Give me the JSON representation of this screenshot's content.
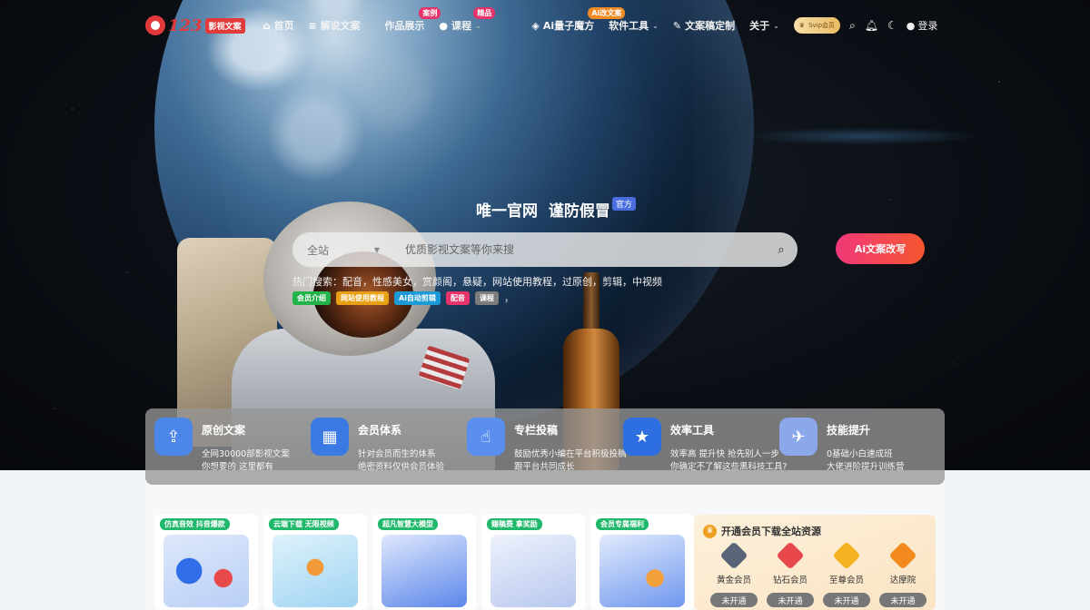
{
  "header": {
    "logo": {
      "number": "123",
      "text": "影视文案"
    },
    "nav": [
      {
        "label": "首页",
        "icon": "home-icon",
        "glyph": "⌂",
        "dropdown": false,
        "tag": ""
      },
      {
        "label": "解说文案",
        "icon": "layers-icon",
        "glyph": "≡",
        "dropdown": true,
        "tag": ""
      },
      {
        "label": "作品展示",
        "icon": "",
        "glyph": "",
        "dropdown": false,
        "tag": "案例"
      },
      {
        "label": "课程",
        "icon": "user-icon",
        "glyph": "●",
        "dropdown": true,
        "tag": "精品"
      },
      {
        "label": "Ai量子魔方",
        "icon": "cube-icon",
        "glyph": "◈",
        "dropdown": false,
        "tag": "Ai改文案"
      },
      {
        "label": "软件工具",
        "icon": "",
        "glyph": "",
        "dropdown": true,
        "tag": ""
      },
      {
        "label": "文案稿定制",
        "icon": "edit-icon",
        "glyph": "✎",
        "dropdown": false,
        "tag": ""
      },
      {
        "label": "关于",
        "icon": "",
        "glyph": "",
        "dropdown": true,
        "tag": ""
      }
    ],
    "svip_label": "Svip会员",
    "login_label": "登录"
  },
  "hero": {
    "slogan": "唯一官网  谨防假冒",
    "badge": "官方",
    "search_scope": "全站",
    "search_placeholder": "优质影视文案等你来搜",
    "ai_button": "Ai文案改写",
    "hot_search": "热门搜索：配音，性感美女，赏颜阁，悬疑，网站使用教程，过原创，剪辑，中视频",
    "chips": [
      {
        "label": "会员介绍",
        "color": "#24b24a"
      },
      {
        "label": "网站使用教程",
        "color": "#e8a114"
      },
      {
        "label": "Ai自动剪辑",
        "color": "#1c9ad6"
      },
      {
        "label": "配音",
        "color": "#e8336a"
      },
      {
        "label": "课程",
        "color": "#7d7d7d"
      }
    ],
    "chips_trail": "，"
  },
  "features": [
    {
      "title": "原创文案",
      "desc1": "全网30000部影视文案",
      "desc2": "你想要的 这里都有",
      "icon": "cloud-upload-icon",
      "glyph": "⇪",
      "color": "#4b86e8"
    },
    {
      "title": "会员体系",
      "desc1": "针对会员而生的体系",
      "desc2": "绝密资料仅供会员体验",
      "icon": "grid-icon",
      "glyph": "▦",
      "color": "#3b7ae2"
    },
    {
      "title": "专栏投稿",
      "desc1": "鼓励优秀小编在平台积极投稿",
      "desc2": "跟平台共同成长",
      "icon": "touch-screen-icon",
      "glyph": "☝",
      "color": "#5a8ff0"
    },
    {
      "title": "效率工具",
      "desc1": "效率高 提升快 抢先别人一步",
      "desc2": "你确定不了解这些黑科技工具?",
      "icon": "star-tool-icon",
      "glyph": "★",
      "color": "#2d6fe0"
    },
    {
      "title": "技能提升",
      "desc1": "0基础小白速成班",
      "desc2": "大佬进阶提升训练营",
      "icon": "send-icon",
      "glyph": "✈",
      "color": "#8aa8ea"
    }
  ],
  "cards": [
    {
      "label": "仿真音效 抖音爆款",
      "icon": "headphone-mic-icon"
    },
    {
      "label": "云端下载 无限视频",
      "icon": "cloud-download-icon"
    },
    {
      "label": "超凡智慧大模型",
      "icon": "ai-computer-icon"
    },
    {
      "label": "赚稿费 拿奖励",
      "icon": "document-reward-icon"
    },
    {
      "label": "会员专属福利",
      "icon": "member-gift-icon"
    }
  ],
  "vip": {
    "title": "开通会员下载全站资源",
    "tiers": [
      {
        "name": "黄金会员",
        "status": "未开通",
        "icon": "gold-crown-icon",
        "color": "#5a6478"
      },
      {
        "name": "钻石会员",
        "status": "未开通",
        "icon": "diamond-icon",
        "color": "#e8474c"
      },
      {
        "name": "至尊会员",
        "status": "未开通",
        "icon": "supreme-icon",
        "color": "#f3b21f"
      },
      {
        "name": "达摩院",
        "status": "未开通",
        "icon": "damo-icon",
        "color": "#f28a1e"
      }
    ]
  }
}
